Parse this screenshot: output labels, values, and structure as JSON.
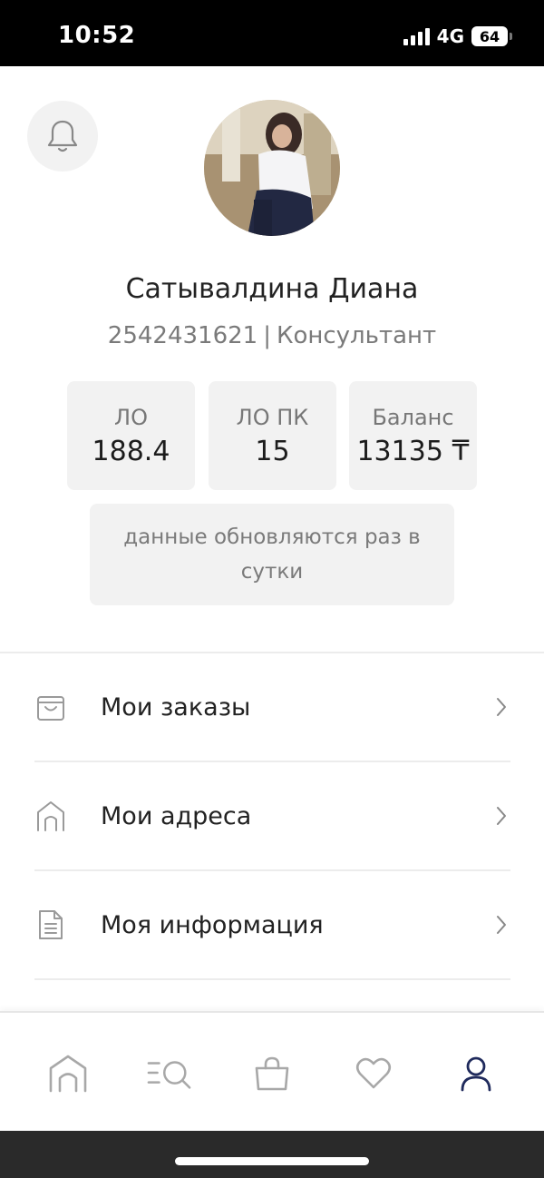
{
  "status_bar": {
    "time": "10:52",
    "network": "4G",
    "battery": "64"
  },
  "profile": {
    "name": "Сатывалдина Диана",
    "id": "2542431621",
    "separator": "|",
    "role": "Консультант"
  },
  "stats": [
    {
      "label": "ЛО",
      "value": "188.4"
    },
    {
      "label": "ЛО ПК",
      "value": "15"
    },
    {
      "label": "Баланс",
      "value": "13135 ₸"
    }
  ],
  "notice": "данные обновляются раз в сутки",
  "menu": [
    {
      "label": "Мои заказы",
      "icon": "bag-icon"
    },
    {
      "label": "Мои адреса",
      "icon": "home-icon"
    },
    {
      "label": "Моя информация",
      "icon": "document-icon"
    }
  ],
  "tab_bar": {
    "tabs": [
      "home-icon",
      "catalog-search-icon",
      "cart-bag-icon",
      "heart-icon",
      "profile-icon"
    ],
    "active": "profile-icon",
    "active_color": "#1f2a5c",
    "inactive_color": "#a8a8a8"
  }
}
